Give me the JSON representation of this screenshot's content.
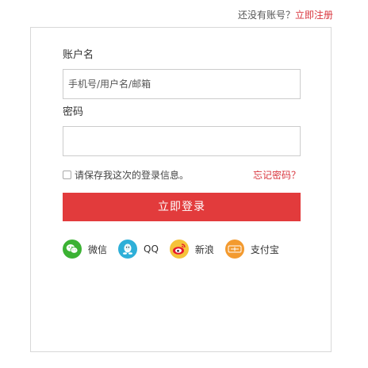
{
  "header": {
    "prompt_text": "还没有账号？",
    "register_link": "立即注册"
  },
  "form": {
    "account_label": "账户名",
    "account_placeholder": "手机号/用户名/邮箱",
    "account_value": "",
    "password_label": "密码",
    "password_value": "",
    "remember_label": "请保存我这次的登录信息。",
    "remember_checked": false,
    "forgot_link": "忘记密码？",
    "login_button": "立即登录"
  },
  "social_logins": [
    {
      "label": "微信",
      "icon": "wechat-icon",
      "color": "#3bb233"
    },
    {
      "label": "QQ",
      "icon": "qq-icon",
      "color": "#2eafd8"
    },
    {
      "label": "新浪",
      "icon": "weibo-icon",
      "color": "#e6162d"
    },
    {
      "label": "支付宝",
      "icon": "alipay-icon",
      "color": "#f39a2f"
    }
  ],
  "colors": {
    "accent": "#e23b3c",
    "link_red": "#d9363e"
  }
}
